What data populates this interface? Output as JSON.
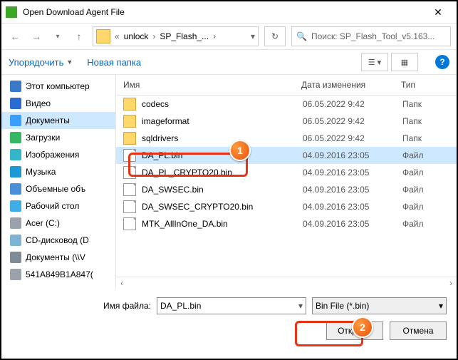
{
  "title": "Open Download Agent File",
  "breadcrumb": {
    "a": "unlock",
    "b": "SP_Flash_...",
    "prefix": "«"
  },
  "search": {
    "placeholder": "Поиск: SP_Flash_Tool_v5.163..."
  },
  "toolbar": {
    "organize": "Упорядочить",
    "newfolder": "Новая папка"
  },
  "sidebar": [
    {
      "label": "Этот компьютер",
      "color": "#3a78c9"
    },
    {
      "label": "Видео",
      "color": "#2a6bd1"
    },
    {
      "label": "Документы",
      "color": "#3aa0ff",
      "selected": true
    },
    {
      "label": "Загрузки",
      "color": "#35b861"
    },
    {
      "label": "Изображения",
      "color": "#33b6c7"
    },
    {
      "label": "Музыка",
      "color": "#1d98d6"
    },
    {
      "label": "Объемные объ",
      "color": "#4b8fd9"
    },
    {
      "label": "Рабочий стол",
      "color": "#3faee6"
    },
    {
      "label": "Acer (C:)",
      "color": "#9aa3ab"
    },
    {
      "label": "CD-дисковод (D",
      "color": "#7cb3d6"
    },
    {
      "label": "Документы (\\\\V",
      "color": "#7e8c97"
    },
    {
      "label": "541A849B1A847(",
      "color": "#9aa3ab"
    }
  ],
  "columns": {
    "name": "Имя",
    "date": "Дата изменения",
    "type": "Тип"
  },
  "files": [
    {
      "kind": "folder",
      "name": "codecs",
      "date": "06.05.2022 9:42",
      "type": "Папк"
    },
    {
      "kind": "folder",
      "name": "imageformat",
      "date": "06.05.2022 9:42",
      "type": "Папк"
    },
    {
      "kind": "folder",
      "name": "sqldrivers",
      "date": "06.05.2022 9:42",
      "type": "Папк"
    },
    {
      "kind": "file",
      "name": "DA_PL.bin",
      "date": "04.09.2016 23:05",
      "type": "Файл",
      "selected": true
    },
    {
      "kind": "file",
      "name": "DA_PL_CRYPTO20.bin",
      "date": "04.09.2016 23:05",
      "type": "Файл"
    },
    {
      "kind": "file",
      "name": "DA_SWSEC.bin",
      "date": "04.09.2016 23:05",
      "type": "Файл"
    },
    {
      "kind": "file",
      "name": "DA_SWSEC_CRYPTO20.bin",
      "date": "04.09.2016 23:05",
      "type": "Файл"
    },
    {
      "kind": "file",
      "name": "MTK_AllInOne_DA.bin",
      "date": "04.09.2016 23:05",
      "type": "Файл"
    }
  ],
  "filename": {
    "label": "Имя файла:",
    "value": "DA_PL.bin"
  },
  "filter": {
    "value": "Bin File (*.bin)"
  },
  "buttons": {
    "open": "Открыть",
    "cancel": "Отмена"
  },
  "badges": {
    "b1": "1",
    "b2": "2"
  }
}
